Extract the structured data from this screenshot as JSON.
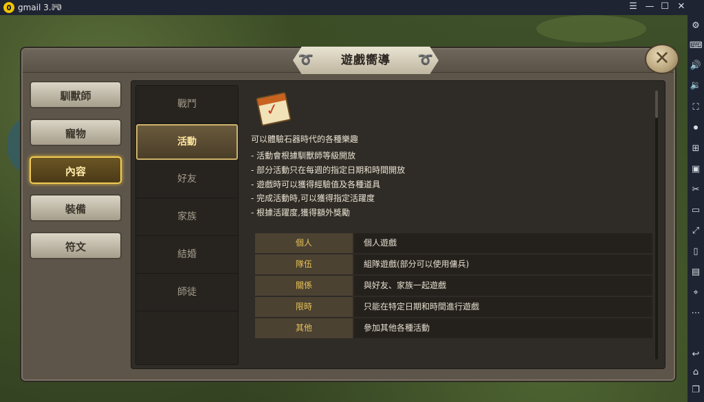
{
  "emulator": {
    "app_name": "gmail 3.70",
    "window_controls": [
      "☰",
      "—",
      "☐",
      "✕"
    ],
    "toolbar_icons": [
      "settings-icon",
      "keyboard-icon",
      "volume-up-icon",
      "volume-down-icon",
      "fullscreen-icon",
      "record-icon",
      "add-screen-icon",
      "screenshot-icon",
      "cut-icon",
      "video-icon",
      "resize-icon",
      "shake-icon",
      "install-icon",
      "location-icon",
      "more-icon",
      "back-icon",
      "home-icon",
      "recent-icon"
    ]
  },
  "window": {
    "title": "遊戲嚮導",
    "close_glyph": "✕"
  },
  "categories": [
    {
      "label": "馴獸師",
      "active": false
    },
    {
      "label": "寵物",
      "active": false
    },
    {
      "label": "內容",
      "active": true
    },
    {
      "label": "裝備",
      "active": false
    },
    {
      "label": "符文",
      "active": false
    }
  ],
  "subtabs": [
    {
      "label": "戰鬥",
      "active": false
    },
    {
      "label": "活動",
      "active": true
    },
    {
      "label": "好友",
      "active": false
    },
    {
      "label": "家族",
      "active": false
    },
    {
      "label": "結婚",
      "active": false
    },
    {
      "label": "師徒",
      "active": false
    }
  ],
  "detail": {
    "icon": "calendar-icon",
    "intro": "可以體驗石器時代的各種樂趣",
    "bullets": [
      "-  活動會根據馴獸師等級開放",
      "-  部分活動只在每週的指定日期和時間開放",
      "-  遊戲時可以獲得經驗值及各種道具",
      "-  完成活動時,可以獲得指定活躍度",
      "-  根據活躍度,獲得額外獎勵"
    ],
    "table": [
      {
        "key": "個人",
        "value": "個人遊戲"
      },
      {
        "key": "隊伍",
        "value": "組隊遊戲(部分可以使用傭兵)"
      },
      {
        "key": "關係",
        "value": "與好友、家族一起遊戲"
      },
      {
        "key": "限時",
        "value": "只能在特定日期和時間進行遊戲"
      },
      {
        "key": "其他",
        "value": "參加其他各種活動"
      }
    ]
  },
  "colors": {
    "accent_gold": "#f2cc55",
    "table_key_text": "#e8c257",
    "emulator_bar": "#1e2432"
  }
}
